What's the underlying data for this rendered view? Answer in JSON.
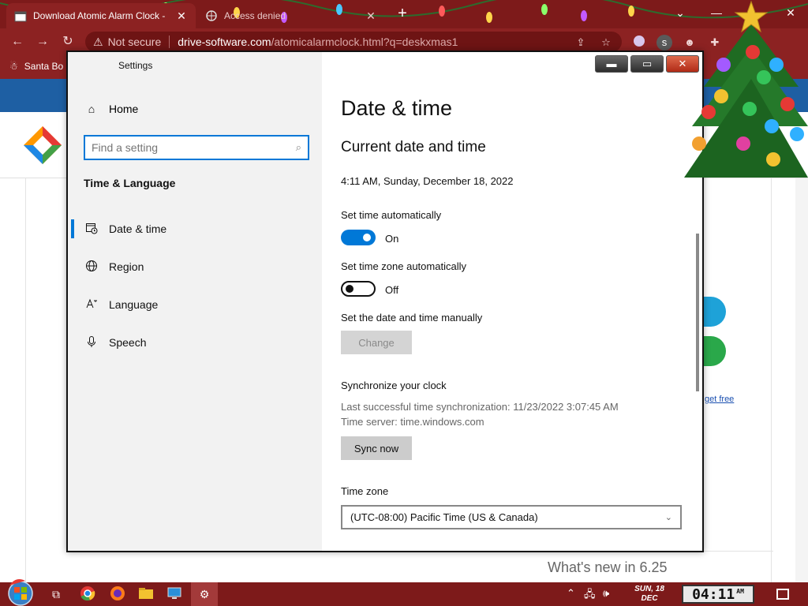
{
  "browser": {
    "tabs": [
      {
        "title": "Download Atomic Alarm Clock -",
        "active": true
      },
      {
        "title": "Access denied",
        "active": false
      }
    ],
    "address": {
      "security_label": "Not secure",
      "host": "drive-software.com",
      "path": "/atomicalarmclock.html?q=deskxmas1"
    },
    "profile_letter": "s",
    "bookmark": "Santa Bo"
  },
  "webpage": {
    "link_text": "get free",
    "whats_new": "What's new in 6.25"
  },
  "settings": {
    "window_title": "Settings",
    "sidebar": {
      "home_label": "Home",
      "search_placeholder": "Find a setting",
      "section_title": "Time & Language",
      "items": [
        {
          "label": "Date & time",
          "icon": "calendar-clock-icon",
          "selected": true
        },
        {
          "label": "Region",
          "icon": "globe-icon",
          "selected": false
        },
        {
          "label": "Language",
          "icon": "language-icon",
          "selected": false
        },
        {
          "label": "Speech",
          "icon": "microphone-icon",
          "selected": false
        }
      ]
    },
    "content": {
      "page_title": "Date & time",
      "section_current": "Current date and time",
      "current_datetime": "4:11 AM, Sunday, December 18, 2022",
      "set_time_auto": {
        "label": "Set time automatically",
        "state": "On",
        "on": true
      },
      "set_tz_auto": {
        "label": "Set time zone automatically",
        "state": "Off",
        "on": false
      },
      "manual": {
        "label": "Set the date and time manually",
        "button": "Change"
      },
      "sync": {
        "title": "Synchronize your clock",
        "last_sync": "Last successful time synchronization: 11/23/2022 3:07:45 AM",
        "server": "Time server: time.windows.com",
        "button": "Sync now"
      },
      "timezone": {
        "label": "Time zone",
        "value": "(UTC-08:00) Pacific Time (US & Canada)"
      }
    }
  },
  "taskbar": {
    "date_line1": "SUN, 18",
    "date_line2": "DEC",
    "clock": "04:11",
    "ampm": "AM"
  },
  "colors": {
    "accent": "#0078d7",
    "chrome": "#8c2222",
    "taskbar": "#7d1a1a"
  }
}
